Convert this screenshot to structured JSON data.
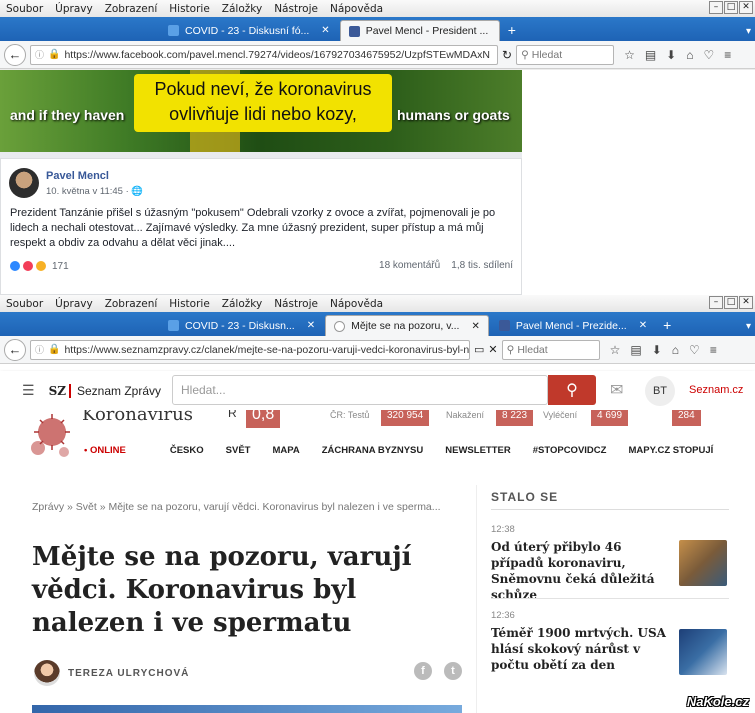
{
  "window1": {
    "menu": [
      "Soubor",
      "Úpravy",
      "Zobrazení",
      "Historie",
      "Záložky",
      "Nástroje",
      "Nápověda"
    ],
    "tabs": [
      {
        "label": "COVID - 23 - Diskusní fó...",
        "active": false
      },
      {
        "label": "Pavel Mencl - President ...",
        "active": true
      }
    ],
    "url": "https://www.facebook.com/pavel.mencl.79274/videos/167927034675952/UzpfSTEwMDAxN",
    "search_placeholder": "Hledat",
    "video": {
      "subtitle_line1": "Pokud neví, že koronavirus",
      "subtitle_line2": "ovlivňuje lidi nebo kozy,",
      "en_left": "and if they haven",
      "en_right": "humans or goats"
    },
    "post": {
      "author": "Pavel Mencl",
      "date": "10. května v 11:45 ·",
      "text": "Prezident Tanzánie přišel s úžasným \"pokusem\" Odebrali vzorky z ovoce a zvířat, pojmenovali je po lidech a nechali otestovat... Zajímavé výsledky. Za mne úžasný prezident, super přístup a má můj respekt a obdiv za odvahu a dělat věci jinak....",
      "reactions": "171",
      "comments": "18 komentářů",
      "shares": "1,8 tis. sdílení"
    }
  },
  "window2": {
    "menu": [
      "Soubor",
      "Úpravy",
      "Zobrazení",
      "Historie",
      "Záložky",
      "Nástroje",
      "Nápověda"
    ],
    "tabs": [
      {
        "label": "COVID - 23 - Diskusn...",
        "active": false
      },
      {
        "label": "Mějte se na pozoru, v...",
        "active": true
      },
      {
        "label": "Pavel Mencl - Prezide...",
        "active": false
      }
    ],
    "url": "https://www.seznamzpravy.cz/clanek/mejte-se-na-pozoru-varuji-vedci-koronavirus-byl-n",
    "search_placeholder": "Hledat"
  },
  "sz_header": {
    "logo_mark": "SZ",
    "logo_text": "Seznam Zprávy",
    "search_placeholder": "Hledat...",
    "avatar": "BT",
    "seznam_link": "Seznam.cz"
  },
  "covid": {
    "title": "Koronavirus",
    "r_label": "R",
    "r_value": "0,8",
    "stats": [
      {
        "label": "ČR: Testů",
        "value": "320 954"
      },
      {
        "label": "Nakažení",
        "value": "8 223"
      },
      {
        "label": "Vyléčení",
        "value": "4 699"
      },
      {
        "label": "",
        "value": "284"
      }
    ],
    "nav": [
      "• ONLINE",
      "ČESKO",
      "SVĚT",
      "MAPA",
      "ZÁCHRANA BYZNYSU",
      "NEWSLETTER",
      "#STOPCOVIDCZ",
      "MAPY.CZ STOPUJÍ"
    ]
  },
  "article": {
    "breadcrumb": "Zprávy  »  Svět  »  Mějte se na pozoru, varují vědci. Koronavirus byl nalezen i ve sperma...",
    "title": "Mějte se na pozoru, varují vědci. Koronavirus byl nalezen i ve spermatu",
    "author": "TEREZA ULRYCHOVÁ"
  },
  "stalo_se": {
    "heading": "STALO SE",
    "items": [
      {
        "time": "12:38",
        "text": "Od úterý přibylo 46 případů koronaviru, Sněmovnu čeká důležitá schůze"
      },
      {
        "time": "12:36",
        "text": "Téměř 1900 mrtvých. USA hlásí skokový nárůst v počtu obětí za den"
      }
    ]
  },
  "watermark": "NaKole.cz",
  "colors": {
    "firefox_tabbar": "#2b78c9",
    "seznam_red": "#c0392b",
    "facebook_blue": "#385898"
  }
}
